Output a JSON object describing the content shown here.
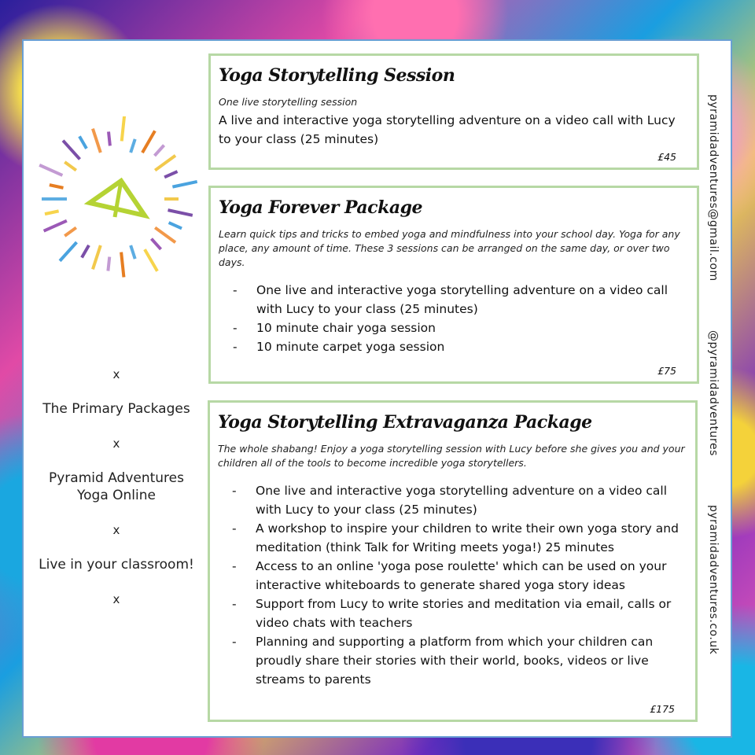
{
  "sidebar": {
    "separator": "x",
    "items": [
      "The Primary Packages",
      "Pyramid Adventures Yoga Online",
      "Live in your classroom!"
    ]
  },
  "contact": {
    "email": "pyramidadventures@gmail.com",
    "handle": "@pyramidadventures",
    "website": "pyramidadventures.co.uk"
  },
  "packages": [
    {
      "title": "Yoga Storytelling Session",
      "subtitle": "One live storytelling session",
      "description": "A live and interactive yoga storytelling adventure on a video call with Lucy to your class  (25 minutes)",
      "price": "£45"
    },
    {
      "title": "Yoga Forever Package",
      "subtitle": "Learn quick tips and tricks to embed yoga and mindfulness into your school day.  Yoga for any place, any amount of time.  These 3 sessions can be arranged on the same day, or over two days.",
      "items": [
        "One live and interactive yoga storytelling adventure on a video call with Lucy to your class (25 minutes)",
        "10 minute chair yoga session",
        "10 minute carpet yoga session"
      ],
      "price": "£75"
    },
    {
      "title": "Yoga Storytelling Extravaganza Package",
      "subtitle": "The whole shabang!  Enjoy a yoga storytelling session with Lucy before she gives you and your children all of the tools to become incredible yoga storytellers.",
      "items": [
        "One live and interactive yoga storytelling adventure on a video call with Lucy to your class (25 minutes)",
        "A workshop to inspire your children to write their own yoga story and meditation (think Talk for Writing meets yoga!) 25 minutes",
        "Access to an online 'yoga pose roulette' which can be used on your interactive whiteboards to generate shared yoga story ideas",
        "Support from Lucy to write stories and meditation via email, calls or video chats with teachers",
        "Planning and supporting a  platform from which your children can proudly share their stories with their world, books, videos or live streams to parents"
      ],
      "price": "£175"
    }
  ],
  "colors": {
    "card_border": "#b7d8a5",
    "panel_border": "#6a9fd4",
    "logo_triangle": "#b5d334"
  },
  "icons": [
    "pyramid-sunburst-logo"
  ]
}
